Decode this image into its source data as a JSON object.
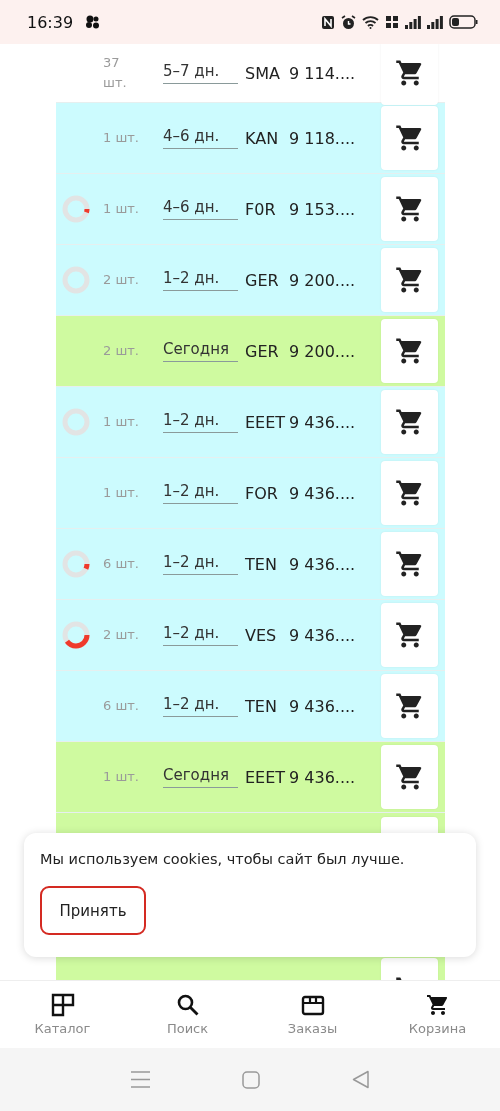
{
  "status_bar": {
    "time": "16:39"
  },
  "rows": [
    {
      "color": "#ffffff",
      "qty": "37 шт.",
      "delivery": "5–7 дн.",
      "name": "SMA",
      "price": "9 114...."
    },
    {
      "color": "#ccfbfe",
      "qty": "1 шт.",
      "delivery": "4–6 дн.",
      "name": "KAN",
      "price": "9 118...."
    },
    {
      "color": "#ccfbfe",
      "level": 0.05,
      "qty": "1 шт.",
      "delivery": "4–6 дн.",
      "name": "F0R",
      "price": "9 153...."
    },
    {
      "color": "#ccfbfe",
      "level": 0,
      "qty": "2 шт.",
      "delivery": "1–2 дн.",
      "name": "GER",
      "price": "9 200...."
    },
    {
      "color": "#cffaa0",
      "qty": "2 шт.",
      "delivery": "Сегодня",
      "name": "GER",
      "price": "9 200...."
    },
    {
      "color": "#ccfbfe",
      "level": 0,
      "qty": "1 шт.",
      "delivery": "1–2 дн.",
      "name": "EEET",
      "price": "9 436...."
    },
    {
      "color": "#ccfbfe",
      "qty": "1 шт.",
      "delivery": "1–2 дн.",
      "name": "FOR",
      "price": "9 436...."
    },
    {
      "color": "#ccfbfe",
      "level": 0.07,
      "qty": "6 шт.",
      "delivery": "1–2 дн.",
      "name": "TEN",
      "price": "9 436...."
    },
    {
      "color": "#ccfbfe",
      "level": 0.4,
      "qty": "2 шт.",
      "delivery": "1–2 дн.",
      "name": "VES",
      "price": "9 436...."
    },
    {
      "color": "#ccfbfe",
      "qty": "6 шт.",
      "delivery": "1–2 дн.",
      "name": "TEN",
      "price": "9 436...."
    },
    {
      "color": "#cffaa0",
      "qty": "1 шт.",
      "delivery": "Сегодня",
      "name": "EEET",
      "price": "9 436...."
    },
    {
      "color": "#cffaa0"
    },
    {
      "color": "#cffaa0"
    }
  ],
  "cookie_notice": {
    "text": "Мы используем cookies, чтобы сайт был лучше.",
    "button": "Принять"
  },
  "bottom_nav": [
    {
      "kind": "catalog",
      "label": "Каталог"
    },
    {
      "kind": "search",
      "label": "Поиск"
    },
    {
      "kind": "orders",
      "label": "Заказы"
    },
    {
      "kind": "cart",
      "label": "Корзина"
    }
  ]
}
